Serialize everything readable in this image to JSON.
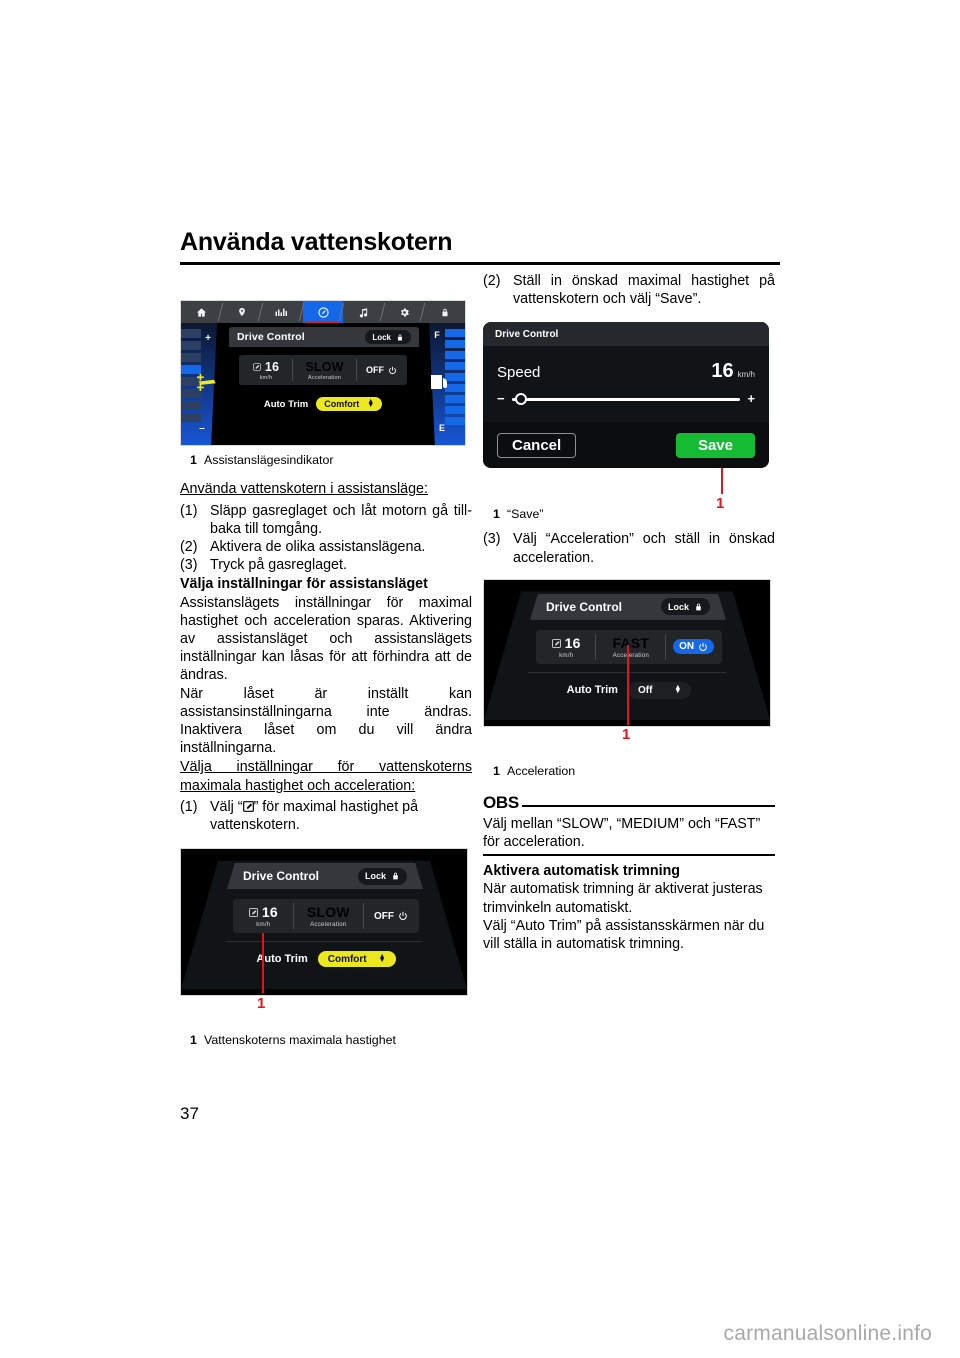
{
  "page": {
    "chapter_title": "Använda vattenskotern",
    "number": "37",
    "watermark": "carmanualsonline.info"
  },
  "left_column": {
    "figure1": {
      "callout": "1",
      "caption_num": "1",
      "caption_text": "Assistanslägesindikator",
      "nav_icons": [
        "home-icon",
        "location-pin-icon",
        "bar-chart-icon",
        "speedometer-icon",
        "music-note-icon",
        "gear-icon",
        "lock-icon"
      ],
      "active_nav_index": 3,
      "drive_control_title": "Drive Control",
      "lock_label": "Lock",
      "speed_value": "16",
      "speed_unit": "km/h",
      "accel_value": "SLOW",
      "accel_label": "Acceleration",
      "power_label": "OFF",
      "auto_trim_label": "Auto Trim",
      "auto_trim_value": "Comfort",
      "gauge_left_plus": "+",
      "gauge_left_minus": "−",
      "gauge_right_full": "F",
      "gauge_right_empty": "E"
    },
    "heading1": "Använda vattenskotern i assistansläge:",
    "steps1": [
      {
        "num": "(1)",
        "text": "Släpp gasreglaget och låt motorn gå till-baka till tomgång."
      },
      {
        "num": "(2)",
        "text": "Aktivera de olika assistanslägena."
      },
      {
        "num": "(3)",
        "text": "Tryck på gasreglaget."
      }
    ],
    "heading2": "Välja inställningar för assistansläget",
    "para1": "Assistanslägets inställningar för maximal hastighet och acceleration sparas. Aktivering av assistansläget och assistanslägets inställningar kan låsas för att förhindra att de ändras.",
    "para2": "När låset är inställt kan assistansinställningarna inte ändras. Inaktivera låset om du vill ändra inställningarna.",
    "heading3": "Välja inställningar för vattenskoterns maximala hastighet och acceleration:",
    "step_a_num": "(1)",
    "step_a_text_before": "Välj “",
    "step_a_text_after": "” för maximal hastighet på vattenskotern.",
    "figure2": {
      "callout": "1",
      "caption_num": "1",
      "caption_text": "Vattenskoterns maximala hastighet",
      "drive_control_title": "Drive Control",
      "lock_label": "Lock",
      "speed_value": "16",
      "speed_unit": "km/h",
      "accel_value": "SLOW",
      "accel_label": "Acceleration",
      "power_label": "OFF",
      "auto_trim_label": "Auto Trim",
      "auto_trim_value": "Comfort"
    }
  },
  "right_column": {
    "step2_num": "(2)",
    "step2_text": "Ställ in önskad maximal hastighet på vattenskotern och välj “Save”.",
    "dialog": {
      "callout": "1",
      "title": "Drive Control",
      "speed_label": "Speed",
      "speed_value": "16",
      "speed_unit": "km/h",
      "minus": "−",
      "plus": "+",
      "cancel_label": "Cancel",
      "save_label": "Save",
      "caption_num": "1",
      "caption_text": "“Save”"
    },
    "step3_num": "(3)",
    "step3_text": "Välj “Acceleration” och ställ in önskad acceleration.",
    "figure3": {
      "callout": "1",
      "caption_num": "1",
      "caption_text": "Acceleration",
      "drive_control_title": "Drive Control",
      "lock_label": "Lock",
      "speed_value": "16",
      "speed_unit": "km/h",
      "accel_value": "FAST",
      "accel_label": "Acceleration",
      "power_label": "ON",
      "auto_trim_label": "Auto Trim",
      "auto_trim_value": "Off"
    },
    "obs": {
      "word": "OBS",
      "text": "Välj mellan “SLOW”, “MEDIUM” och “FAST” för acceleration."
    },
    "heading_trim": "Aktivera automatisk trimning",
    "para_trim1": "När automatisk trimning är aktiverat justeras trimvinkeln automatiskt.",
    "para_trim2": "Välj “Auto Trim” på assistansskärmen när du vill ställa in automatisk trimning."
  },
  "colors": {
    "accent_blue": "#1569e8",
    "accent_red": "#d61f26",
    "accent_yellow": "#ece81f",
    "accent_green": "#15bb33",
    "callout_red": "#e8131a"
  }
}
